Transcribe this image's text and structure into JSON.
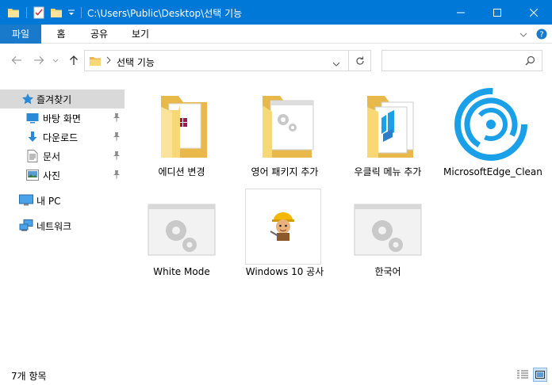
{
  "window": {
    "title": "C:\\Users\\Public\\Desktop\\선택 기능"
  },
  "ribbon": {
    "tabs": [
      {
        "label": "파일"
      },
      {
        "label": "홈"
      },
      {
        "label": "공유"
      },
      {
        "label": "보기"
      }
    ]
  },
  "address": {
    "path_segment": "선택 기능",
    "search_placeholder": ""
  },
  "nav": {
    "items": [
      {
        "label": "즐겨찾기",
        "icon": "star-icon",
        "selected": true
      },
      {
        "label": "바탕 화면",
        "icon": "desktop-icon",
        "pinned": true
      },
      {
        "label": "다운로드",
        "icon": "download-icon",
        "pinned": true
      },
      {
        "label": "문서",
        "icon": "document-icon",
        "pinned": true
      },
      {
        "label": "사진",
        "icon": "pictures-icon",
        "pinned": true
      },
      {
        "label": "내 PC",
        "icon": "computer-icon"
      },
      {
        "label": "네트워크",
        "icon": "network-icon"
      }
    ]
  },
  "content": {
    "items": [
      {
        "name": "에디션 변경",
        "kind": "folder"
      },
      {
        "name": "영어 패키지 추가",
        "kind": "folder"
      },
      {
        "name": "우클릭 메뉴 추가",
        "kind": "folder"
      },
      {
        "name": "MicrosoftEdge_Clean",
        "kind": "app"
      },
      {
        "name": "White Mode",
        "kind": "settings-file"
      },
      {
        "name": "Windows 10 공사",
        "kind": "worker-file"
      },
      {
        "name": "한국어",
        "kind": "settings-file"
      }
    ]
  },
  "status": {
    "item_count": "7개 항목"
  },
  "colors": {
    "titlebar": "#0078d7",
    "file_tab": "#1979ca",
    "selection": "#d9d9d9",
    "folder": "#f8d775",
    "edge_blue": "#1aa0e8"
  }
}
